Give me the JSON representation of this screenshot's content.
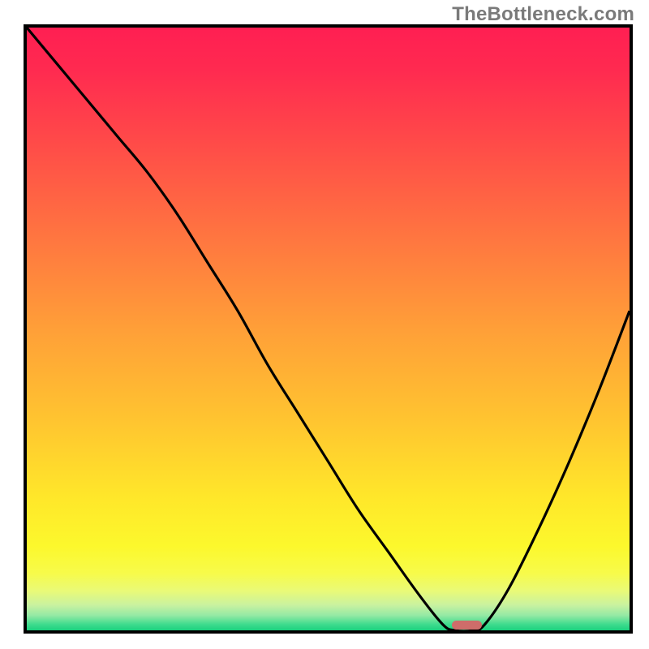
{
  "watermark": "TheBottleneck.com",
  "chart_data": {
    "type": "line",
    "title": "",
    "xlabel": "",
    "ylabel": "",
    "xlim": [
      0,
      100
    ],
    "ylim": [
      0,
      100
    ],
    "grid": false,
    "legend": false,
    "series": [
      {
        "name": "bottleneck-curve",
        "x": [
          0,
          5,
          10,
          15,
          20,
          25,
          30,
          35,
          40,
          45,
          50,
          55,
          60,
          65,
          69,
          71,
          74,
          76,
          80,
          85,
          90,
          95,
          100
        ],
        "values": [
          100,
          94,
          88,
          82,
          76,
          69,
          61,
          53,
          44,
          36,
          28,
          20,
          13,
          6,
          1,
          0,
          0,
          1,
          7,
          17,
          28,
          40,
          53
        ]
      }
    ],
    "gradient_stops": [
      {
        "pos": 0.0,
        "color": "#ff1f52"
      },
      {
        "pos": 0.07,
        "color": "#ff2a50"
      },
      {
        "pos": 0.2,
        "color": "#ff4d48"
      },
      {
        "pos": 0.35,
        "color": "#ff7640"
      },
      {
        "pos": 0.5,
        "color": "#ff9f38"
      },
      {
        "pos": 0.65,
        "color": "#ffc430"
      },
      {
        "pos": 0.78,
        "color": "#ffe72a"
      },
      {
        "pos": 0.86,
        "color": "#fcf82c"
      },
      {
        "pos": 0.905,
        "color": "#f7fb4a"
      },
      {
        "pos": 0.935,
        "color": "#e9fa78"
      },
      {
        "pos": 0.958,
        "color": "#c9f2a0"
      },
      {
        "pos": 0.975,
        "color": "#95e9a4"
      },
      {
        "pos": 0.99,
        "color": "#3fdc8e"
      },
      {
        "pos": 1.0,
        "color": "#1bd07e"
      }
    ],
    "marker": {
      "color": "#ce6d6a",
      "x_start": 70.5,
      "x_end": 75.5,
      "y": 0.8
    }
  }
}
